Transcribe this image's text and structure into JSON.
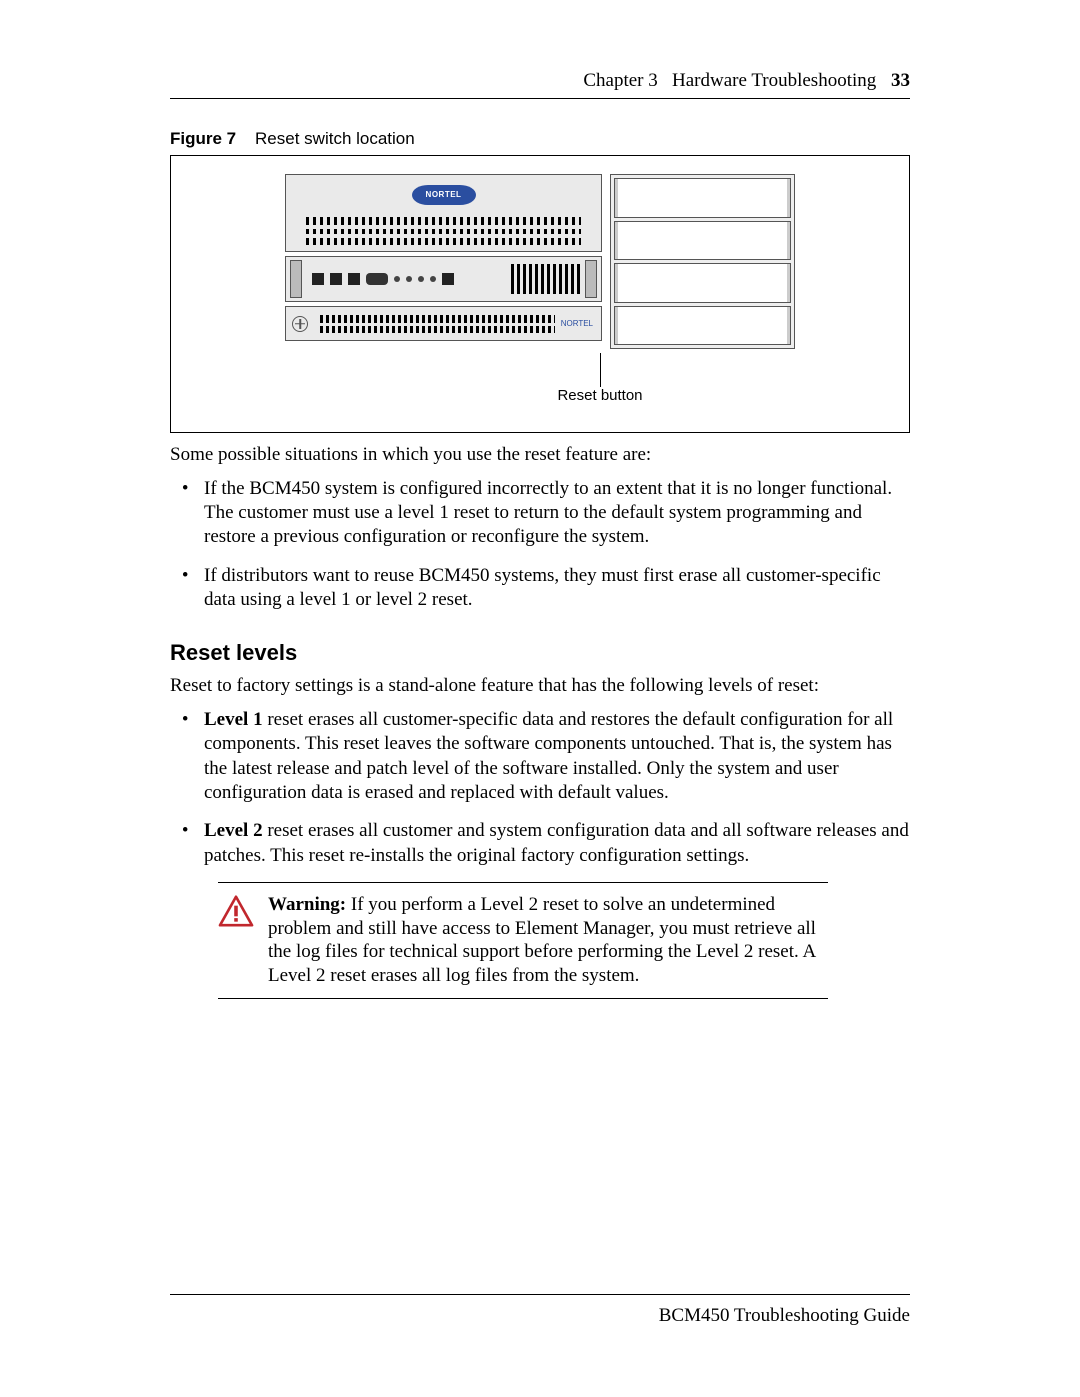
{
  "header": {
    "chapter_label": "Chapter 3",
    "chapter_title": "Hardware Troubleshooting",
    "page_number": "33"
  },
  "figure": {
    "label": "Figure 7",
    "caption": "Reset switch location",
    "brand_text": "NORTEL",
    "tiny_label": "NORTEL",
    "callout_label": "Reset button"
  },
  "body": {
    "intro": "Some possible situations in which you use the reset feature are:",
    "situations": [
      "If the BCM450 system is configured incorrectly to an extent that it is no longer functional. The customer must use a level 1 reset to return to the default system programming and restore a previous configuration or reconfigure the system.",
      "If distributors want to reuse BCM450 systems, they must first erase all customer-specific data using a level 1 or level 2 reset."
    ],
    "section_heading": "Reset levels",
    "section_intro": "Reset to factory settings is a stand-alone feature that has the following levels of reset:",
    "levels": [
      {
        "bold": "Level 1",
        "rest": " reset erases all customer-specific data and restores the default configuration for all components. This reset leaves the software components untouched. That is, the system has the latest release and patch level of the software installed. Only the system and user configuration data is erased and replaced with default values."
      },
      {
        "bold": "Level 2",
        "rest": " reset erases all customer and system configuration data and all software releases and patches. This reset re-installs the original factory configuration settings."
      }
    ],
    "warning": {
      "bold": "Warning:",
      "text": " If you perform a Level 2 reset to solve an undetermined problem and still have access to Element Manager, you must retrieve all the log files for technical support before performing the Level 2 reset. A Level 2 reset erases all log files from the system."
    }
  },
  "footer": {
    "doc_title": "BCM450 Troubleshooting Guide"
  }
}
